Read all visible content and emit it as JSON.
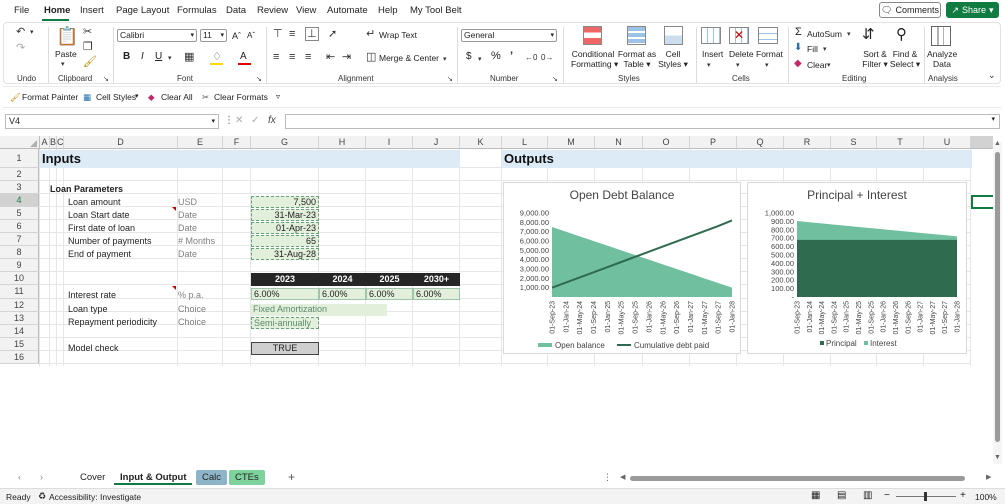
{
  "menu": {
    "items": [
      "File",
      "Home",
      "Insert",
      "Page Layout",
      "Formulas",
      "Data",
      "Review",
      "View",
      "Automate",
      "Help",
      "My Tool Belt"
    ],
    "comments": "Comments",
    "share": "Share"
  },
  "ribbon": {
    "groups": [
      "Undo",
      "Clipboard",
      "Font",
      "Alignment",
      "Number",
      "Styles",
      "Cells",
      "Editing",
      "Analysis"
    ],
    "paste": "Paste",
    "font_name": "Calibri",
    "font_size": "11",
    "wrap_text": "Wrap Text",
    "merge_center": "Merge & Center",
    "number_format": "General",
    "cond_format": [
      "Conditional",
      "Formatting"
    ],
    "format_table": [
      "Format as",
      "Table"
    ],
    "cell_styles": [
      "Cell",
      "Styles"
    ],
    "insert": "Insert",
    "delete": "Delete",
    "format": "Format",
    "autosum": "AutoSum",
    "fill": "Fill",
    "clear": "Clear",
    "sort_filter": [
      "Sort &",
      "Filter"
    ],
    "find_select": [
      "Find &",
      "Select"
    ],
    "analyze": [
      "Analyze",
      "Data"
    ]
  },
  "quickbar": {
    "format_painter": "Format Painter",
    "cell_styles": "Cell Styles",
    "clear_all": "Clear All",
    "clear_formats": "Clear Formats"
  },
  "namebox": "V4",
  "fx": "fx",
  "columns": [
    "A",
    "B",
    "C",
    "D",
    "E",
    "F",
    "G",
    "H",
    "I",
    "J",
    "K",
    "L",
    "M",
    "N",
    "O",
    "P",
    "Q",
    "R",
    "S",
    "T",
    "U"
  ],
  "rows": [
    "1",
    "2",
    "3",
    "4",
    "5",
    "6",
    "7",
    "8",
    "9",
    "10",
    "11",
    "12",
    "13",
    "14",
    "15",
    "16"
  ],
  "sheet": {
    "inputs_title": "Inputs",
    "outputs_title": "Outputs",
    "loan_params": "Loan Parameters",
    "labels": [
      "Loan amount",
      "Loan Start date",
      "First date of loan",
      "Number of payments",
      "End of payment"
    ],
    "units": [
      "USD",
      "Date",
      "Date",
      "# Months",
      "Date"
    ],
    "values": [
      "7,500",
      "31-Mar-23",
      "01-Apr-23",
      "65",
      "31-Aug-28"
    ],
    "years": [
      "2023",
      "2024",
      "2025",
      "2030+"
    ],
    "interest_label": "Interest rate",
    "interest_unit": "% p.a.",
    "interest_values": [
      "6.00%",
      "6.00%",
      "6.00%",
      "6.00%"
    ],
    "loan_type_label": "Loan type",
    "loan_type_unit": "Choice",
    "loan_type_value": "Fixed Amortization",
    "period_label": "Repayment periodicity",
    "period_unit": "Choice",
    "period_value": "Semi-annually",
    "model_check_label": "Model check",
    "model_check_value": "TRUE"
  },
  "chart_data": [
    {
      "type": "area",
      "title": "Open Debt Balance",
      "x": [
        "01-Sep-23",
        "01-Jan-24",
        "01-May-24",
        "01-Sep-24",
        "01-Jan-25",
        "01-May-25",
        "01-Sep-25",
        "01-Jan-26",
        "01-May-26",
        "01-Sep-26",
        "01-Jan-27",
        "01-May-27",
        "01-Sep-27",
        "01-Jan-28"
      ],
      "ylim": [
        0,
        9000
      ],
      "yticks": [
        "9,000.00",
        "8,000.00",
        "7,000.00",
        "6,000.00",
        "5,000.00",
        "4,000.00",
        "3,000.00",
        "2,000.00",
        "1,000.00"
      ],
      "series": [
        {
          "name": "Open balance",
          "type": "area",
          "color": "#70bf9e",
          "values": [
            7500,
            7000,
            6500,
            6000,
            5500,
            5000,
            4500,
            4000,
            3500,
            3000,
            2500,
            2000,
            1500,
            1000
          ]
        },
        {
          "name": "Cumulative debt paid",
          "type": "line",
          "color": "#2e6b4f",
          "values": [
            1000,
            1550,
            2100,
            2650,
            3200,
            3750,
            4300,
            4850,
            5400,
            5950,
            6500,
            7050,
            7600,
            8200
          ]
        }
      ],
      "legend": "bottom"
    },
    {
      "type": "area",
      "title": "Principal + Interest",
      "x": [
        "01-Sep-23",
        "01-Jan-24",
        "01-May-24",
        "01-Sep-24",
        "01-Jan-25",
        "01-May-25",
        "01-Sep-25",
        "01-Jan-26",
        "01-May-26",
        "01-Sep-26",
        "01-Jan-27",
        "01-May-27",
        "01-Sep-27",
        "01-Jan-28"
      ],
      "ylim": [
        0,
        1000
      ],
      "yticks": [
        "1,000.00",
        "900.00",
        "800.00",
        "700.00",
        "600.00",
        "500.00",
        "400.00",
        "300.00",
        "200.00",
        "100.00",
        "-"
      ],
      "series": [
        {
          "name": "Principal",
          "type": "area",
          "color": "#2e6b4f",
          "values": [
            680,
            680,
            680,
            680,
            680,
            680,
            680,
            680,
            680,
            680,
            680,
            680,
            680,
            680
          ]
        },
        {
          "name": "Interest",
          "type": "area",
          "color": "#70bf9e",
          "values": [
            225,
            210,
            196,
            182,
            168,
            154,
            140,
            126,
            112,
            98,
            84,
            70,
            56,
            42
          ]
        }
      ],
      "legend": "bottom"
    }
  ],
  "tabs": {
    "items": [
      "Cover",
      "Input & Output",
      "Calc",
      "CTEs"
    ],
    "add": "+"
  },
  "status": {
    "ready": "Ready",
    "accessibility": "Accessibility: Investigate",
    "zoom": "100%"
  }
}
